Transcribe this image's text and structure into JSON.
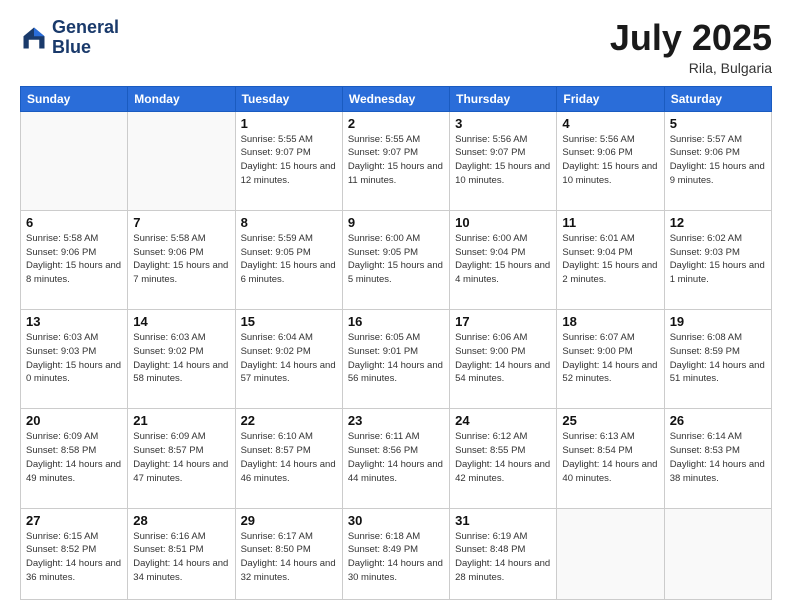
{
  "header": {
    "logo_line1": "General",
    "logo_line2": "Blue",
    "title": "July 2025",
    "location": "Rila, Bulgaria"
  },
  "weekdays": [
    "Sunday",
    "Monday",
    "Tuesday",
    "Wednesday",
    "Thursday",
    "Friday",
    "Saturday"
  ],
  "weeks": [
    [
      {
        "day": "",
        "info": ""
      },
      {
        "day": "",
        "info": ""
      },
      {
        "day": "1",
        "info": "Sunrise: 5:55 AM\nSunset: 9:07 PM\nDaylight: 15 hours\nand 12 minutes."
      },
      {
        "day": "2",
        "info": "Sunrise: 5:55 AM\nSunset: 9:07 PM\nDaylight: 15 hours\nand 11 minutes."
      },
      {
        "day": "3",
        "info": "Sunrise: 5:56 AM\nSunset: 9:07 PM\nDaylight: 15 hours\nand 10 minutes."
      },
      {
        "day": "4",
        "info": "Sunrise: 5:56 AM\nSunset: 9:06 PM\nDaylight: 15 hours\nand 10 minutes."
      },
      {
        "day": "5",
        "info": "Sunrise: 5:57 AM\nSunset: 9:06 PM\nDaylight: 15 hours\nand 9 minutes."
      }
    ],
    [
      {
        "day": "6",
        "info": "Sunrise: 5:58 AM\nSunset: 9:06 PM\nDaylight: 15 hours\nand 8 minutes."
      },
      {
        "day": "7",
        "info": "Sunrise: 5:58 AM\nSunset: 9:06 PM\nDaylight: 15 hours\nand 7 minutes."
      },
      {
        "day": "8",
        "info": "Sunrise: 5:59 AM\nSunset: 9:05 PM\nDaylight: 15 hours\nand 6 minutes."
      },
      {
        "day": "9",
        "info": "Sunrise: 6:00 AM\nSunset: 9:05 PM\nDaylight: 15 hours\nand 5 minutes."
      },
      {
        "day": "10",
        "info": "Sunrise: 6:00 AM\nSunset: 9:04 PM\nDaylight: 15 hours\nand 4 minutes."
      },
      {
        "day": "11",
        "info": "Sunrise: 6:01 AM\nSunset: 9:04 PM\nDaylight: 15 hours\nand 2 minutes."
      },
      {
        "day": "12",
        "info": "Sunrise: 6:02 AM\nSunset: 9:03 PM\nDaylight: 15 hours\nand 1 minute."
      }
    ],
    [
      {
        "day": "13",
        "info": "Sunrise: 6:03 AM\nSunset: 9:03 PM\nDaylight: 15 hours\nand 0 minutes."
      },
      {
        "day": "14",
        "info": "Sunrise: 6:03 AM\nSunset: 9:02 PM\nDaylight: 14 hours\nand 58 minutes."
      },
      {
        "day": "15",
        "info": "Sunrise: 6:04 AM\nSunset: 9:02 PM\nDaylight: 14 hours\nand 57 minutes."
      },
      {
        "day": "16",
        "info": "Sunrise: 6:05 AM\nSunset: 9:01 PM\nDaylight: 14 hours\nand 56 minutes."
      },
      {
        "day": "17",
        "info": "Sunrise: 6:06 AM\nSunset: 9:00 PM\nDaylight: 14 hours\nand 54 minutes."
      },
      {
        "day": "18",
        "info": "Sunrise: 6:07 AM\nSunset: 9:00 PM\nDaylight: 14 hours\nand 52 minutes."
      },
      {
        "day": "19",
        "info": "Sunrise: 6:08 AM\nSunset: 8:59 PM\nDaylight: 14 hours\nand 51 minutes."
      }
    ],
    [
      {
        "day": "20",
        "info": "Sunrise: 6:09 AM\nSunset: 8:58 PM\nDaylight: 14 hours\nand 49 minutes."
      },
      {
        "day": "21",
        "info": "Sunrise: 6:09 AM\nSunset: 8:57 PM\nDaylight: 14 hours\nand 47 minutes."
      },
      {
        "day": "22",
        "info": "Sunrise: 6:10 AM\nSunset: 8:57 PM\nDaylight: 14 hours\nand 46 minutes."
      },
      {
        "day": "23",
        "info": "Sunrise: 6:11 AM\nSunset: 8:56 PM\nDaylight: 14 hours\nand 44 minutes."
      },
      {
        "day": "24",
        "info": "Sunrise: 6:12 AM\nSunset: 8:55 PM\nDaylight: 14 hours\nand 42 minutes."
      },
      {
        "day": "25",
        "info": "Sunrise: 6:13 AM\nSunset: 8:54 PM\nDaylight: 14 hours\nand 40 minutes."
      },
      {
        "day": "26",
        "info": "Sunrise: 6:14 AM\nSunset: 8:53 PM\nDaylight: 14 hours\nand 38 minutes."
      }
    ],
    [
      {
        "day": "27",
        "info": "Sunrise: 6:15 AM\nSunset: 8:52 PM\nDaylight: 14 hours\nand 36 minutes."
      },
      {
        "day": "28",
        "info": "Sunrise: 6:16 AM\nSunset: 8:51 PM\nDaylight: 14 hours\nand 34 minutes."
      },
      {
        "day": "29",
        "info": "Sunrise: 6:17 AM\nSunset: 8:50 PM\nDaylight: 14 hours\nand 32 minutes."
      },
      {
        "day": "30",
        "info": "Sunrise: 6:18 AM\nSunset: 8:49 PM\nDaylight: 14 hours\nand 30 minutes."
      },
      {
        "day": "31",
        "info": "Sunrise: 6:19 AM\nSunset: 8:48 PM\nDaylight: 14 hours\nand 28 minutes."
      },
      {
        "day": "",
        "info": ""
      },
      {
        "day": "",
        "info": ""
      }
    ]
  ]
}
